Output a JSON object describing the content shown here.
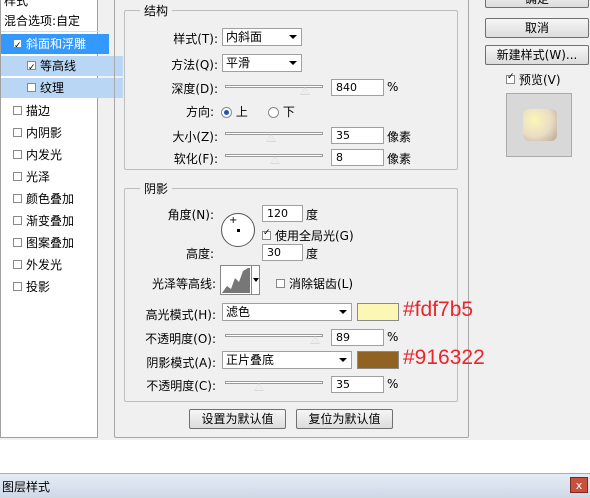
{
  "sidebar": {
    "header_fragment": "样式",
    "blend_options": "混合选项:自定",
    "items": [
      {
        "label": "斜面和浮雕",
        "checked": true
      },
      {
        "label": "等高线",
        "checked": true
      },
      {
        "label": "纹理",
        "checked": false
      },
      {
        "label": "描边",
        "checked": false
      },
      {
        "label": "内阴影",
        "checked": false
      },
      {
        "label": "内发光",
        "checked": false
      },
      {
        "label": "光泽",
        "checked": false
      },
      {
        "label": "颜色叠加",
        "checked": false
      },
      {
        "label": "渐变叠加",
        "checked": false
      },
      {
        "label": "图案叠加",
        "checked": false
      },
      {
        "label": "外发光",
        "checked": false
      },
      {
        "label": "投影",
        "checked": false
      }
    ]
  },
  "structure": {
    "title": "结构",
    "style_label": "样式(T):",
    "style_value": "内斜面",
    "method_label": "方法(Q):",
    "method_value": "平滑",
    "depth_label": "深度(D):",
    "depth_value": "840",
    "depth_unit": "%",
    "direction_label": "方向:",
    "dir_up": "上",
    "dir_down": "下",
    "size_label": "大小(Z):",
    "size_value": "35",
    "size_unit": "像素",
    "soften_label": "软化(F):",
    "soften_value": "8",
    "soften_unit": "像素"
  },
  "shading": {
    "title": "阴影",
    "angle_label": "角度(N):",
    "angle_value": "120",
    "angle_unit": "度",
    "global_light_label": "使用全局光(G)",
    "altitude_label": "高度:",
    "altitude_value": "30",
    "altitude_unit": "度",
    "gloss_label": "光泽等高线:",
    "antialias_label": "消除锯齿(L)",
    "highlight_label": "高光模式(H):",
    "highlight_value": "滤色",
    "highlight_opacity_label": "不透明度(O):",
    "highlight_opacity": "89",
    "highlight_opacity_unit": "%",
    "shadow_label": "阴影模式(A):",
    "shadow_value": "正片叠底",
    "shadow_opacity_label": "不透明度(C):",
    "shadow_opacity": "35",
    "shadow_opacity_unit": "%"
  },
  "colors": {
    "highlight_hex": "#fdf7b5",
    "shadow_hex": "#916322",
    "annotation_color": "#e8262b"
  },
  "buttons": {
    "ok": "确定",
    "cancel": "取消",
    "new_style": "新建样式(W)...",
    "preview": "预览(V)",
    "make_default": "设置为默认值",
    "reset_default": "复位为默认值"
  },
  "window": {
    "title": "图层样式",
    "close": "x"
  }
}
